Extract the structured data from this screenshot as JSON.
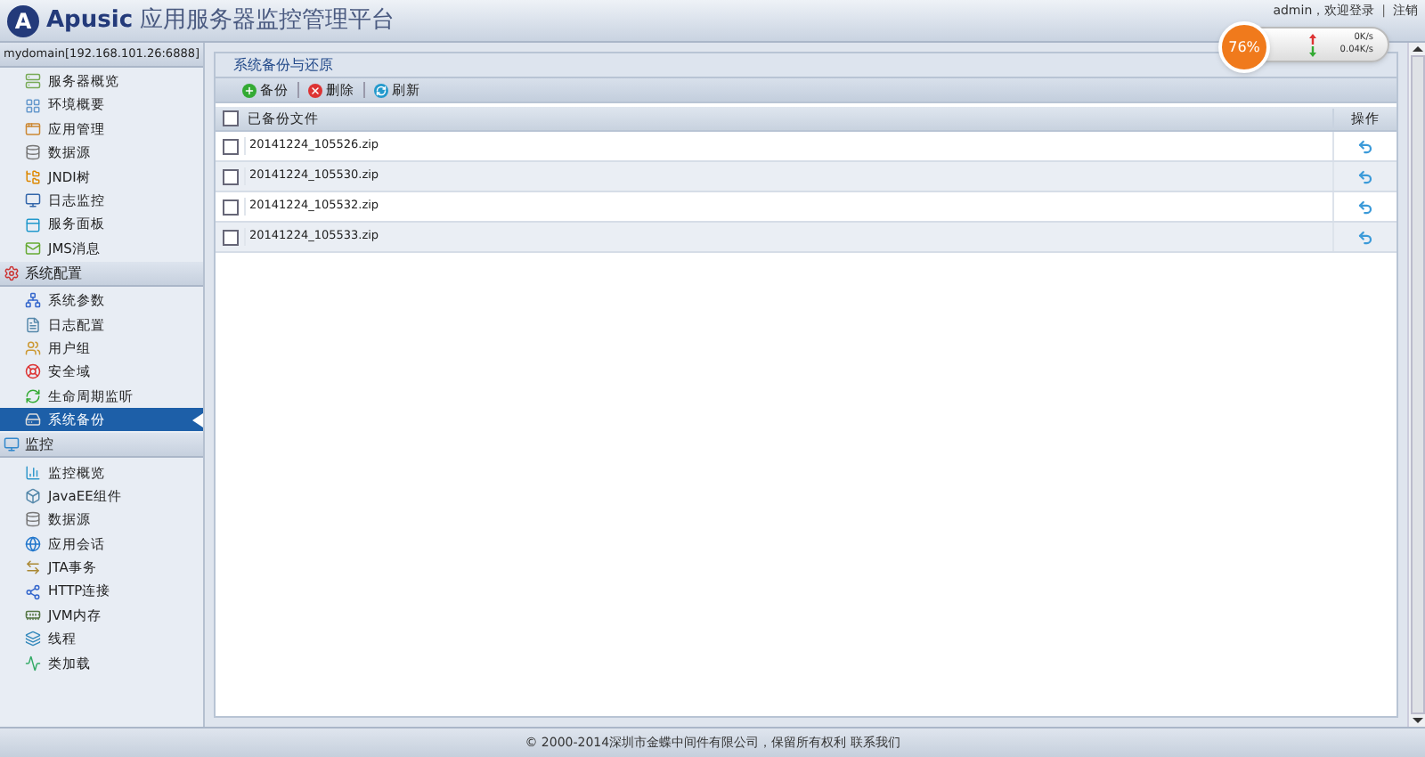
{
  "header": {
    "logo": "A",
    "brand": "Apusic",
    "title": "应用服务器监控管理平台",
    "user": "admin，欢迎登录",
    "separator": "|",
    "logout": "注销"
  },
  "monitor": {
    "percent": "76%",
    "up": "0K/s",
    "down": "0.04K/s"
  },
  "sidebar": {
    "groups": [
      {
        "title": "mydomain[192.168.101.26:6888]",
        "kind": "domain",
        "items": [
          {
            "label": "服务器概览",
            "selected": false
          },
          {
            "label": "环境概要",
            "selected": false
          },
          {
            "label": "应用管理",
            "selected": false
          },
          {
            "label": "数据源",
            "selected": false
          },
          {
            "label": "JNDI树",
            "selected": false
          },
          {
            "label": "日志监控",
            "selected": false
          },
          {
            "label": "服务面板",
            "selected": false
          },
          {
            "label": "JMS消息",
            "selected": false
          }
        ]
      },
      {
        "title": "系统配置",
        "kind": "section",
        "items": [
          {
            "label": "系统参数",
            "selected": false
          },
          {
            "label": "日志配置",
            "selected": false
          },
          {
            "label": "用户组",
            "selected": false
          },
          {
            "label": "安全域",
            "selected": false
          },
          {
            "label": "生命周期监听",
            "selected": false
          },
          {
            "label": "系统备份",
            "selected": true
          }
        ]
      },
      {
        "title": "监控",
        "kind": "section",
        "items": [
          {
            "label": "监控概览",
            "selected": false
          },
          {
            "label": "JavaEE组件",
            "selected": false
          },
          {
            "label": "数据源",
            "selected": false
          },
          {
            "label": "应用会话",
            "selected": false
          },
          {
            "label": "JTA事务",
            "selected": false
          },
          {
            "label": "HTTP连接",
            "selected": false
          },
          {
            "label": "JVM内存",
            "selected": false
          },
          {
            "label": "线程",
            "selected": false
          },
          {
            "label": "类加载",
            "selected": false
          }
        ]
      }
    ]
  },
  "panel": {
    "title": "系统备份与还原",
    "toolbar": [
      {
        "label": "备份",
        "kind": "add"
      },
      {
        "label": "删除",
        "kind": "delete"
      },
      {
        "label": "刷新",
        "kind": "refresh"
      }
    ],
    "select_all_checked": false,
    "columns": [
      "已备份文件",
      "操作"
    ],
    "rows": [
      {
        "file": "20141224_105526.zip",
        "checked": false
      },
      {
        "file": "20141224_105530.zip",
        "checked": false
      },
      {
        "file": "20141224_105532.zip",
        "checked": false
      },
      {
        "file": "20141224_105533.zip",
        "checked": false
      }
    ]
  },
  "footer": "© 2000-2014深圳市金蝶中间件有限公司，保留所有权利 联系我们"
}
